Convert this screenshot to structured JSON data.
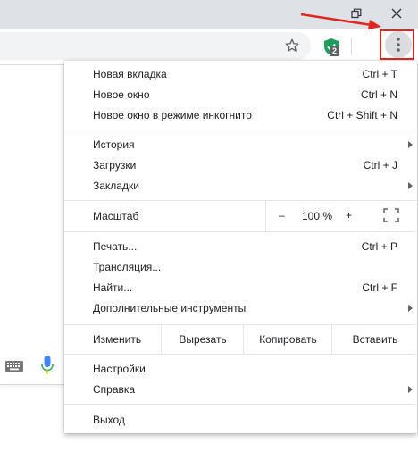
{
  "toolbar": {
    "extension_badge": "2"
  },
  "menu": {
    "group1": [
      {
        "label": "Новая вкладка",
        "shortcut": "Ctrl + T"
      },
      {
        "label": "Новое окно",
        "shortcut": "Ctrl + N"
      },
      {
        "label": "Новое окно в режиме инкогнито",
        "shortcut": "Ctrl + Shift + N"
      }
    ],
    "group2": [
      {
        "label": "История"
      },
      {
        "label": "Загрузки",
        "shortcut": "Ctrl + J"
      },
      {
        "label": "Закладки"
      }
    ],
    "zoom": {
      "label": "Масштаб",
      "minus": "–",
      "value": "100 %",
      "plus": "+"
    },
    "group3": [
      {
        "label": "Печать...",
        "shortcut": "Ctrl + P"
      },
      {
        "label": "Трансляция..."
      },
      {
        "label": "Найти...",
        "shortcut": "Ctrl + F"
      },
      {
        "label": "Дополнительные инструменты"
      }
    ],
    "edit": {
      "label": "Изменить",
      "cut": "Вырезать",
      "copy": "Копировать",
      "paste": "Вставить"
    },
    "group4": [
      {
        "label": "Настройки"
      },
      {
        "label": "Справка"
      }
    ],
    "exit": "Выход"
  },
  "icons": {
    "restore": "restore-icon",
    "close": "close-icon",
    "star": "star-icon",
    "extension": "shield-check-icon",
    "menu": "three-dots-vertical-icon",
    "keyboard": "keyboard-icon",
    "mic": "microphone-icon",
    "fullscreen": "fullscreen-icon",
    "submenu": "submenu-arrow-icon",
    "annotation_arrow": "red-arrow"
  },
  "colors": {
    "highlight": "#e0271f",
    "ext_green": "#1e9e5a",
    "mic_blue": "#4285f4"
  }
}
